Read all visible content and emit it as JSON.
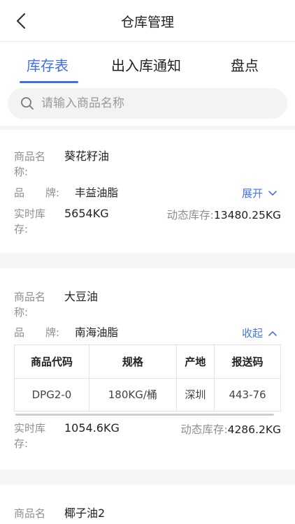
{
  "header": {
    "title": "仓库管理",
    "back_icon": "chevron-left-icon"
  },
  "tabs": [
    {
      "label": "库存表",
      "active": true
    },
    {
      "label": "出入库通知",
      "active": false
    },
    {
      "label": "盘点",
      "active": false
    }
  ],
  "search": {
    "placeholder": "请输入商品名称",
    "icon": "search-icon"
  },
  "labels": {
    "name_line1": "商品名",
    "name_line2": "称:",
    "brand": "品　　牌:",
    "stock_line1": "实时库",
    "stock_line2": "存:",
    "dynamic": "动态库存:"
  },
  "products": [
    {
      "name": "葵花籽油",
      "brand": "丰益油脂",
      "toggle": "展开",
      "stock": "5654KG",
      "dynamic_stock": "13480.25KG"
    },
    {
      "name": "大豆油",
      "brand": "南海油脂",
      "toggle": "收起",
      "stock": "1054.6KG",
      "dynamic_stock": "4286.2KG",
      "table": {
        "headers": [
          "商品代码",
          "规格",
          "产地",
          "报送码"
        ],
        "rows": [
          [
            "DPG2-0",
            "180KG/桶",
            "深圳",
            "443-76"
          ]
        ]
      }
    },
    {
      "name": "椰子油2"
    }
  ],
  "colors": {
    "accent": "#3f6fe0",
    "link": "#4a74e6",
    "separator": "#f5f6f8"
  }
}
